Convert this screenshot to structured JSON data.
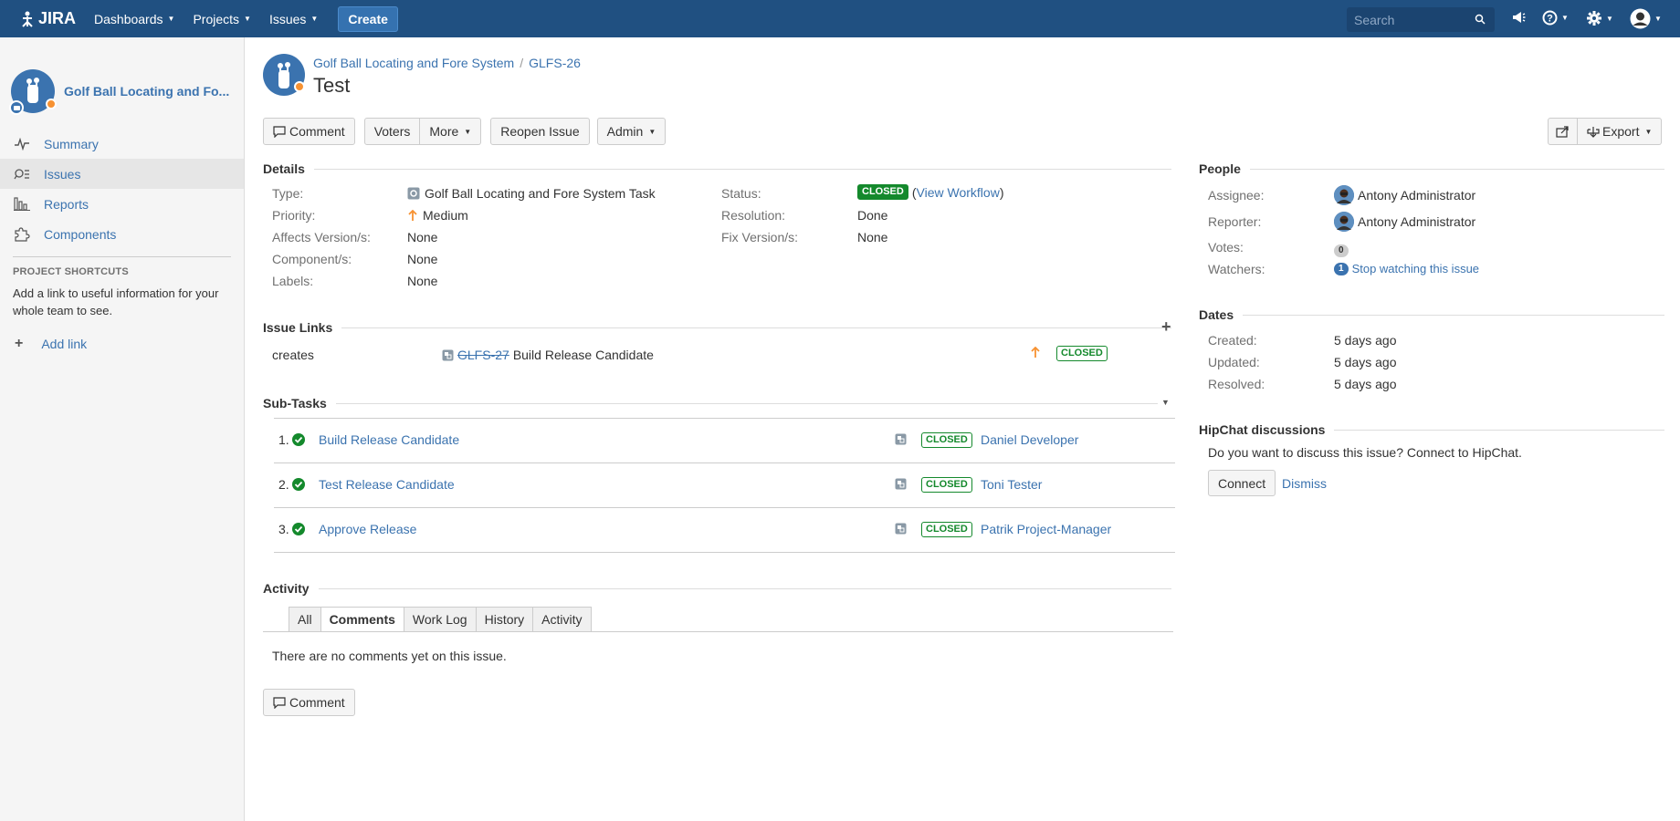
{
  "topnav": {
    "logo_text": "JIRA",
    "items": [
      "Dashboards",
      "Projects",
      "Issues"
    ],
    "create_label": "Create",
    "search_placeholder": "Search"
  },
  "sidebar": {
    "project_name": "Golf Ball Locating and Fo...",
    "items": [
      {
        "label": "Summary",
        "icon": "pulse-icon"
      },
      {
        "label": "Issues",
        "icon": "issues-icon"
      },
      {
        "label": "Reports",
        "icon": "bar-chart-icon"
      },
      {
        "label": "Components",
        "icon": "puzzle-icon"
      }
    ],
    "shortcuts_title": "PROJECT SHORTCUTS",
    "shortcuts_text": "Add a link to useful information for your whole team to see.",
    "add_link_label": "Add link"
  },
  "issue": {
    "project": "Golf Ball Locating and Fore System",
    "key": "GLFS-26",
    "title": "Test"
  },
  "toolbar": {
    "comment": "Comment",
    "voters": "Voters",
    "more": "More",
    "reopen": "Reopen Issue",
    "admin": "Admin",
    "export": "Export"
  },
  "details": {
    "title": "Details",
    "type_label": "Type:",
    "type_value": "Golf Ball Locating and Fore System Task",
    "priority_label": "Priority:",
    "priority_value": "Medium",
    "affects_label": "Affects Version/s:",
    "affects_value": "None",
    "component_label": "Component/s:",
    "component_value": "None",
    "labels_label": "Labels:",
    "labels_value": "None",
    "status_label": "Status:",
    "status_value": "CLOSED",
    "view_workflow": "View Workflow",
    "paren_open": "(",
    "paren_close": ")",
    "resolution_label": "Resolution:",
    "resolution_value": "Done",
    "fix_label": "Fix Version/s:",
    "fix_value": "None"
  },
  "issue_links": {
    "title": "Issue Links",
    "relation": "creates",
    "link_key": "GLFS-27",
    "link_summary": "Build Release Candidate",
    "status": "CLOSED"
  },
  "subtasks": {
    "title": "Sub-Tasks",
    "rows": [
      {
        "num": "1.",
        "summary": "Build Release Candidate",
        "status": "CLOSED",
        "assignee": "Daniel Developer"
      },
      {
        "num": "2.",
        "summary": "Test Release Candidate",
        "status": "CLOSED",
        "assignee": "Toni Tester"
      },
      {
        "num": "3.",
        "summary": "Approve Release",
        "status": "CLOSED",
        "assignee": "Patrik Project-Manager"
      }
    ]
  },
  "activity": {
    "title": "Activity",
    "tabs": [
      "All",
      "Comments",
      "Work Log",
      "History",
      "Activity"
    ],
    "active_tab": "Comments",
    "empty_text": "There are no comments yet on this issue.",
    "comment_button": "Comment"
  },
  "people": {
    "title": "People",
    "assignee_label": "Assignee:",
    "assignee": "Antony Administrator",
    "reporter_label": "Reporter:",
    "reporter": "Antony Administrator",
    "votes_label": "Votes:",
    "votes": "0",
    "watchers_label": "Watchers:",
    "watchers_count": "1",
    "stop_watching": "Stop watching this issue"
  },
  "dates": {
    "title": "Dates",
    "created_label": "Created:",
    "created": "5 days ago",
    "updated_label": "Updated:",
    "updated": "5 days ago",
    "resolved_label": "Resolved:",
    "resolved": "5 days ago"
  },
  "hipchat": {
    "title": "HipChat discussions",
    "text": "Do you want to discuss this issue? Connect to HipChat.",
    "connect": "Connect",
    "dismiss": "Dismiss"
  },
  "colors": {
    "header": "#205081",
    "link": "#3b73af",
    "closed_green": "#14892c",
    "priority_orange": "#f79232"
  }
}
